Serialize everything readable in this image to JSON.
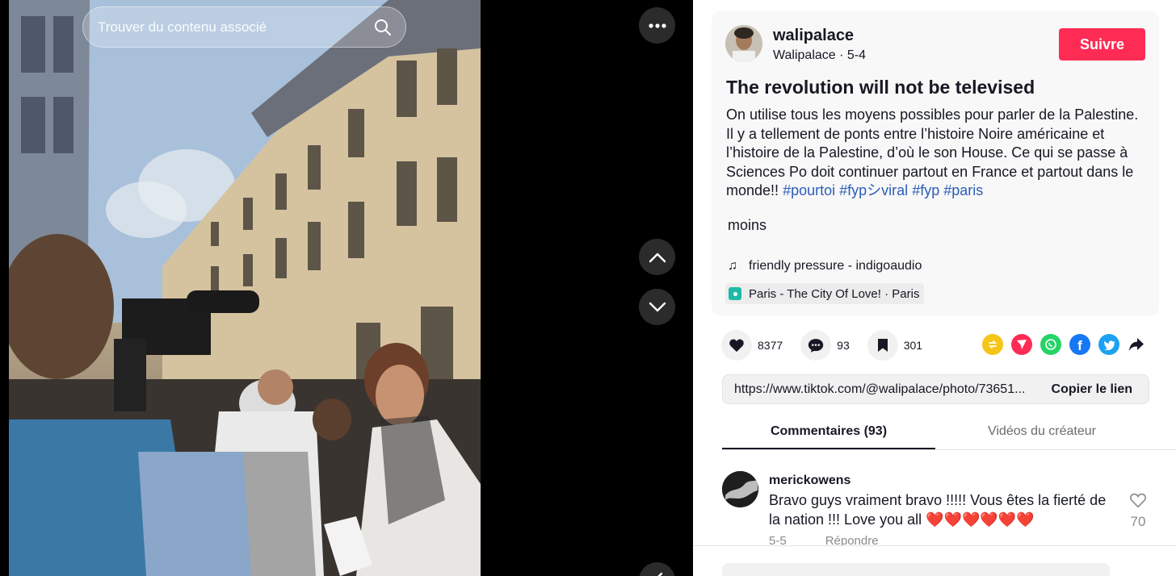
{
  "search": {
    "placeholder": "Trouver du contenu associé"
  },
  "post": {
    "username": "walipalace",
    "display_name": "Walipalace",
    "separator": " · ",
    "date": "5-4",
    "follow_label": "Suivre",
    "title": "The revolution will not be televised",
    "description": "On utilise tous les moyens possibles pour parler de la Palestine. Il y a tellement de ponts entre l’histoire Noire américaine et l’histoire de la Palestine, d’où le son House. Ce qui se passe à Sciences Po doit continuer partout en France et partout dans le monde!!",
    "hashtags": [
      "#pourtoi",
      "#fypシviral",
      "#fyp",
      "#paris"
    ],
    "less_label": "moins",
    "music": "friendly pressure - indigoaudio",
    "location": "Paris - The City Of Love! · Paris"
  },
  "actions": {
    "likes": "8377",
    "comments": "93",
    "saves": "301"
  },
  "share_icons": [
    {
      "name": "repost-icon",
      "color": "#f5c518"
    },
    {
      "name": "send-icon",
      "color": "#fe2c55"
    },
    {
      "name": "whatsapp-icon",
      "color": "#25d366"
    },
    {
      "name": "facebook-icon",
      "color": "#1877f2"
    },
    {
      "name": "twitter-icon",
      "color": "#1da1f2"
    },
    {
      "name": "share-arrow-icon",
      "color": "#161823"
    }
  ],
  "link": {
    "url": "https://www.tiktok.com/@walipalace/photo/73651...",
    "copy_label": "Copier le lien"
  },
  "tabs": [
    {
      "label": "Commentaires (93)",
      "active": true
    },
    {
      "label": "Vidéos du créateur",
      "active": false
    }
  ],
  "comment": {
    "user": "merickowens",
    "text": "Bravo guys vraiment bravo !!!!! Vous êtes la fierté de la nation !!! Love you all ❤️❤️❤️❤️❤️❤️",
    "date": "5-5",
    "reply_label": "Répondre",
    "likes": "70"
  },
  "colors": {
    "accent": "#fe2c55",
    "hashtag": "#2b5db9",
    "location": "#1fb9a8"
  }
}
